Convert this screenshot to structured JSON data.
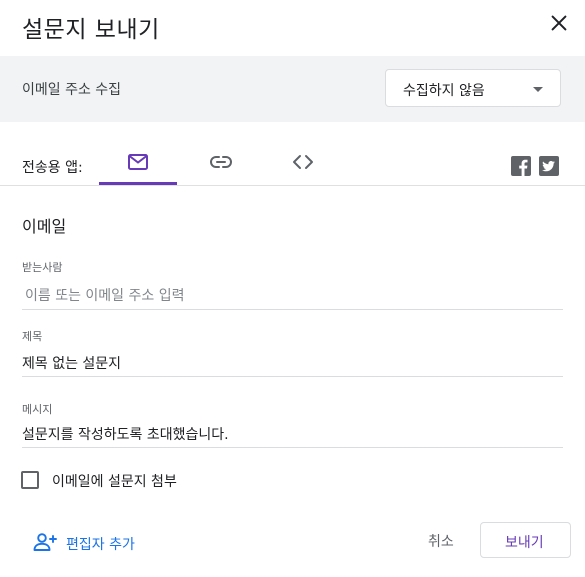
{
  "dialog": {
    "title": "설문지 보내기"
  },
  "collect": {
    "label": "이메일 주소 수집",
    "selected": "수집하지 않음"
  },
  "send_via": {
    "label": "전송용 앱:",
    "active_tab": "email"
  },
  "email_section": {
    "title": "이메일",
    "recipients": {
      "label": "받는사람",
      "placeholder": "이름 또는 이메일 주소 입력",
      "value": ""
    },
    "subject": {
      "label": "제목",
      "value": "제목 없는 설문지"
    },
    "message": {
      "label": "메시지",
      "value": "설문지를 작성하도록 초대했습니다."
    },
    "include_form": {
      "label": "이메일에 설문지 첨부",
      "checked": false
    }
  },
  "footer": {
    "add_editors": "편집자 추가",
    "cancel": "취소",
    "send": "보내기"
  },
  "colors": {
    "accent": "#673ab7",
    "link": "#1a73e8",
    "bar_bg": "#f1f3f4"
  }
}
